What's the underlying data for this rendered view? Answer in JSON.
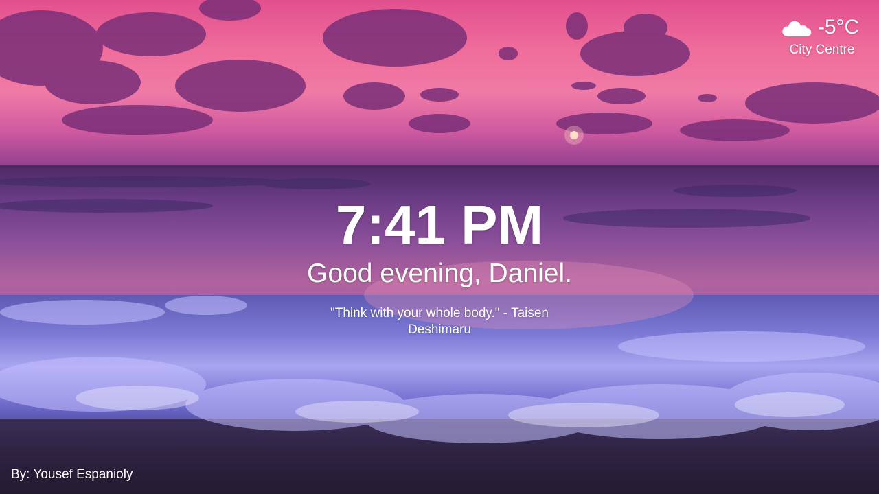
{
  "weather": {
    "icon": "cloud-icon",
    "temperature": "-5°C",
    "location": "City Centre"
  },
  "clock": {
    "time": "7:41 PM"
  },
  "greeting": {
    "text": "Good evening, Daniel."
  },
  "quote": {
    "text": "\"Think with your whole body.\" - Taisen Deshimaru"
  },
  "credit": {
    "text": "By: Yousef Espanioly"
  },
  "colors": {
    "sky": "#ef6d9b",
    "clouds": "#7a2f78",
    "sea": "#6a3c85",
    "surf": "#8f8ce6",
    "sand": "#2e2341",
    "text": "#ffffff"
  }
}
